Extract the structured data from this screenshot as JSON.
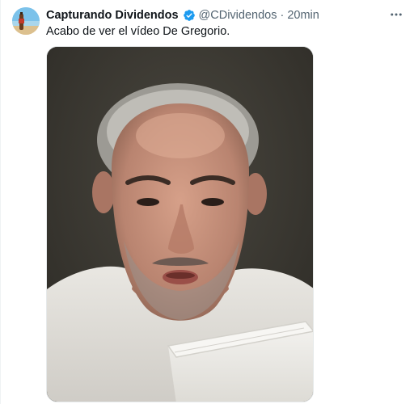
{
  "tweet": {
    "author": {
      "display_name": "Capturando Dividendos",
      "handle": "@CDividendos",
      "verified": true,
      "avatar_icon": "avatar-beach-photo"
    },
    "separator": "·",
    "time": "20min",
    "text": "Acabo de ver el vídeo De Gregorio.",
    "more_icon": "more-horizontal-icon",
    "media": {
      "type": "photo"
    }
  },
  "colors": {
    "primary_text": "#0f1419",
    "secondary_text": "#536471",
    "verified_blue": "#1d9bf0",
    "border": "#eff3f4"
  }
}
